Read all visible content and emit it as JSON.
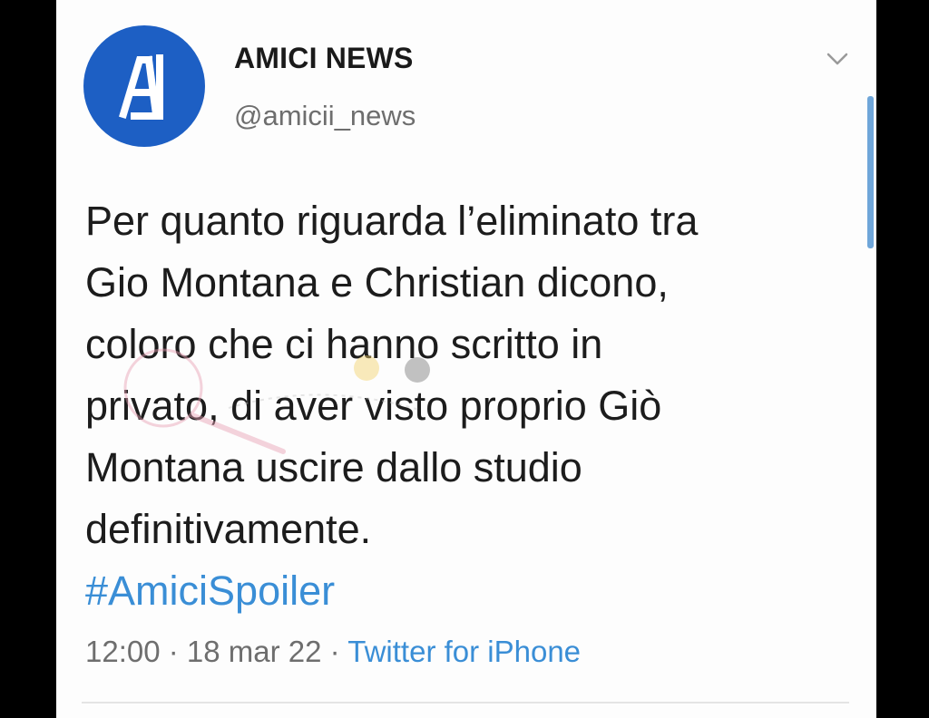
{
  "profile": {
    "display_name": "AMICI NEWS",
    "handle": "@amicii_news",
    "avatar_color": "#1d5fc4"
  },
  "tweet": {
    "lines": [
      "Per quanto riguarda l’eliminato tra",
      "Gio Montana e Christian dicono,",
      "coloro che ci hanno scritto in",
      "privato, di aver visto proprio Giò",
      "Montana uscire dallo studio",
      "definitivamente."
    ],
    "hashtag": "#AmiciSpoiler"
  },
  "meta": {
    "time": "12:00",
    "separator1": " · ",
    "date": "18 mar 22",
    "separator2": " · ",
    "source": "Twitter for iPhone"
  },
  "icons": {
    "menu": "chevron-down-icon",
    "avatar": "logo-icon",
    "watermark": "watermark-stamp"
  },
  "colors": {
    "link": "#3a8ed6",
    "secondary_text": "#6e6e6e",
    "background": "#fdfdfd"
  }
}
